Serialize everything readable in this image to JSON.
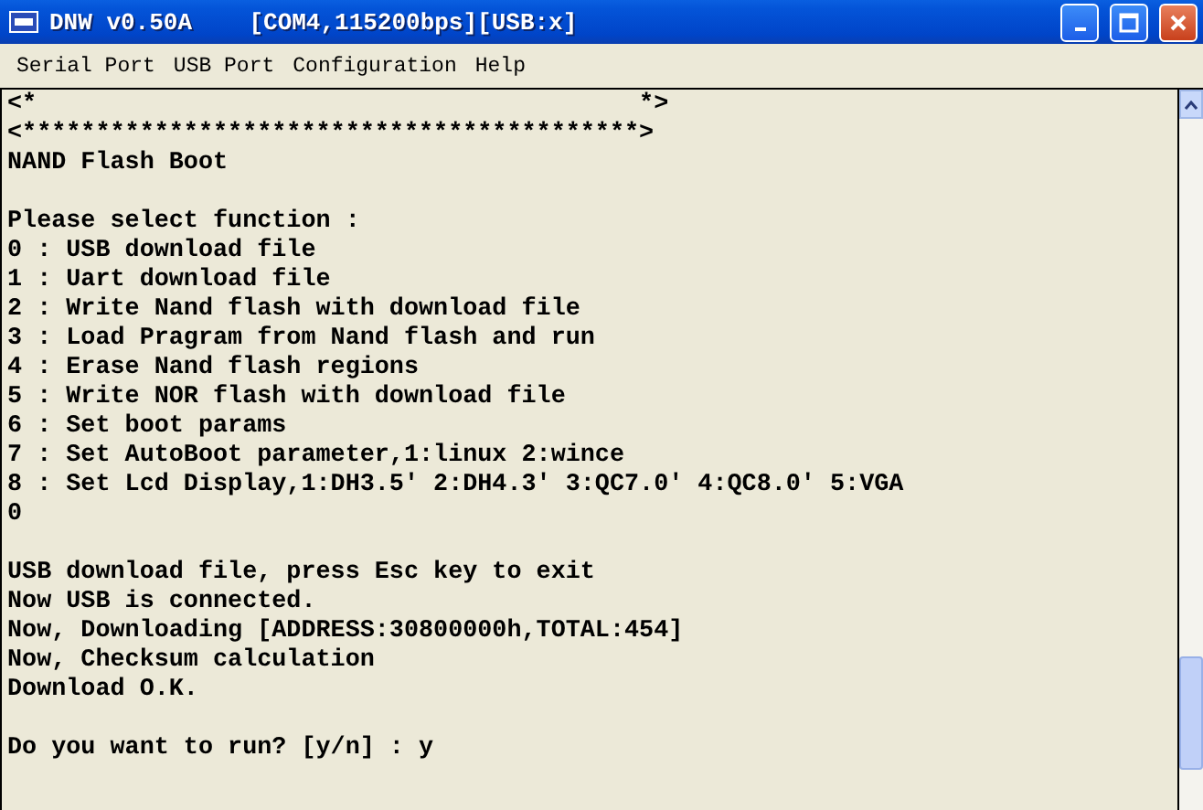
{
  "window": {
    "title": "DNW v0.50A    [COM4,115200bps][USB:x]"
  },
  "menu": [
    "Serial Port",
    "USB Port",
    "Configuration",
    "Help"
  ],
  "terminal": {
    "blocks": [
      [
        "<*                                         *>",
        "<******************************************>",
        "NAND Flash Boot"
      ],
      [
        "Please select function :",
        "0 : USB download file",
        "1 : Uart download file",
        "2 : Write Nand flash with download file",
        "3 : Load Pragram from Nand flash and run",
        "4 : Erase Nand flash regions",
        "5 : Write NOR flash with download file",
        "6 : Set boot params",
        "7 : Set AutoBoot parameter,1:linux 2:wince",
        "8 : Set Lcd Display,1:DH3.5' 2:DH4.3' 3:QC7.0' 4:QC8.0' 5:VGA",
        "0"
      ],
      [
        "USB download file, press Esc key to exit",
        "Now USB is connected.",
        "Now, Downloading [ADDRESS:30800000h,TOTAL:454]",
        "Now, Checksum calculation",
        "Download O.K."
      ],
      [
        "Do you want to run? [y/n] : y"
      ]
    ]
  }
}
